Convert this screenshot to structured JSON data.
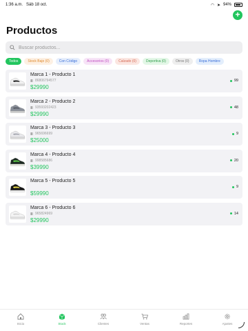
{
  "status_bar": {
    "time": "1:36 a.m.",
    "date": "Sáb 18 oct.",
    "battery": "94%"
  },
  "header": {
    "title": "Productos",
    "add_icon": "+"
  },
  "search": {
    "placeholder": "Buscar productos..."
  },
  "filters": [
    {
      "label": "Todos",
      "bg": "#22c55e",
      "fg": "#ffffff"
    },
    {
      "label": "Stock Bajo (0)",
      "bg": "#fdf0e3",
      "fg": "#e08a2c"
    },
    {
      "label": "Con Código",
      "bg": "#e6eefc",
      "fg": "#3b6fd8"
    },
    {
      "label": "Accesorios (0)",
      "bg": "#f7e4f7",
      "fg": "#c04cc0"
    },
    {
      "label": "Calzado (0)",
      "bg": "#fbe6e1",
      "fg": "#d66a55"
    },
    {
      "label": "Deportiva (0)",
      "bg": "#e3f7e7",
      "fg": "#2e9e4a"
    },
    {
      "label": "Otros (0)",
      "bg": "#eeeeee",
      "fg": "#777777"
    },
    {
      "label": "Ropa Hombre",
      "bg": "#e3eefc",
      "fg": "#3b6fd8"
    }
  ],
  "products": [
    {
      "name": "Marca 1 - Producto 1",
      "code": "86806794577",
      "price": "$29990",
      "stock": "99",
      "shoe": "white-black"
    },
    {
      "name": "Marca 2 - Producto 2",
      "code": "93593202423",
      "price": "$29990",
      "stock": "48",
      "shoe": "grey"
    },
    {
      "name": "Marca 3 - Producto 3",
      "code": "965696699",
      "price": "$25000",
      "stock": "9",
      "shoe": "white-grey"
    },
    {
      "name": "Marca 4 - Producto 4",
      "code": "998585686",
      "price": "$39990",
      "stock": "20",
      "shoe": "black-green"
    },
    {
      "name": "Marca 5 - Producto 5",
      "code": "",
      "price": "$59990",
      "stock": "9",
      "shoe": "black-yellow"
    },
    {
      "name": "Marca 6 - Producto 6",
      "code": "965824969",
      "price": "$29990",
      "stock": "14",
      "shoe": "white"
    }
  ],
  "tab_bar": [
    {
      "label": "Inicio",
      "icon": "house-icon",
      "active": false
    },
    {
      "label": "Stock",
      "icon": "box-icon",
      "active": true
    },
    {
      "label": "Clientes",
      "icon": "people-icon",
      "active": false
    },
    {
      "label": "Ventas",
      "icon": "cart-icon",
      "active": false
    },
    {
      "label": "Reportes",
      "icon": "chart-icon",
      "active": false
    },
    {
      "label": "Ajustes",
      "icon": "gear-icon",
      "active": false
    }
  ],
  "colors": {
    "accent": "#22c55e",
    "card_bg": "#f2f2f5"
  }
}
